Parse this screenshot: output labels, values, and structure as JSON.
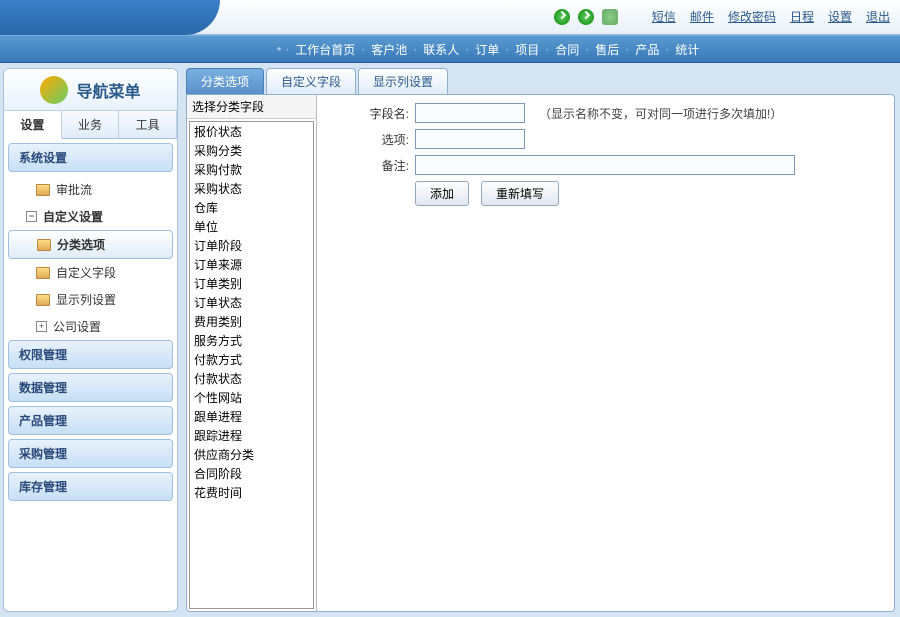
{
  "topLinks": [
    "短信",
    "邮件",
    "修改密码",
    "日程",
    "设置",
    "退出"
  ],
  "navItems": [
    "工作台首页",
    "客户池",
    "联系人",
    "订单",
    "项目",
    "合同",
    "售后",
    "产品",
    "统计"
  ],
  "sidebar": {
    "title": "导航菜单",
    "tabs": [
      "设置",
      "业务",
      "工具"
    ],
    "sections": {
      "systemSettings": "系统设置",
      "approval": "审批流",
      "customSettings": "自定义设置",
      "categoryOptions": "分类选项",
      "customFields": "自定义字段",
      "displayColumns": "显示列设置",
      "companySettings": "公司设置",
      "permMgmt": "权限管理",
      "dataMgmt": "数据管理",
      "productMgmt": "产品管理",
      "purchaseMgmt": "采购管理",
      "stockMgmt": "库存管理"
    }
  },
  "contentTabs": [
    "分类选项",
    "自定义字段",
    "显示列设置"
  ],
  "fieldPanel": {
    "header": "选择分类字段",
    "items": [
      "报价状态",
      "采购分类",
      "采购付款",
      "采购状态",
      "仓库",
      "单位",
      "订单阶段",
      "订单来源",
      "订单类别",
      "订单状态",
      "费用类别",
      "服务方式",
      "付款方式",
      "付款状态",
      "个性网站",
      "跟单进程",
      "跟踪进程",
      "供应商分类",
      "合同阶段",
      "花费时间"
    ]
  },
  "form": {
    "fieldNameLabel": "字段名:",
    "optionsLabel": "选项:",
    "remarkLabel": "备注:",
    "hint": "（显示名称不变，可对同一项进行多次填加!）",
    "addBtn": "添加",
    "resetBtn": "重新填写"
  }
}
